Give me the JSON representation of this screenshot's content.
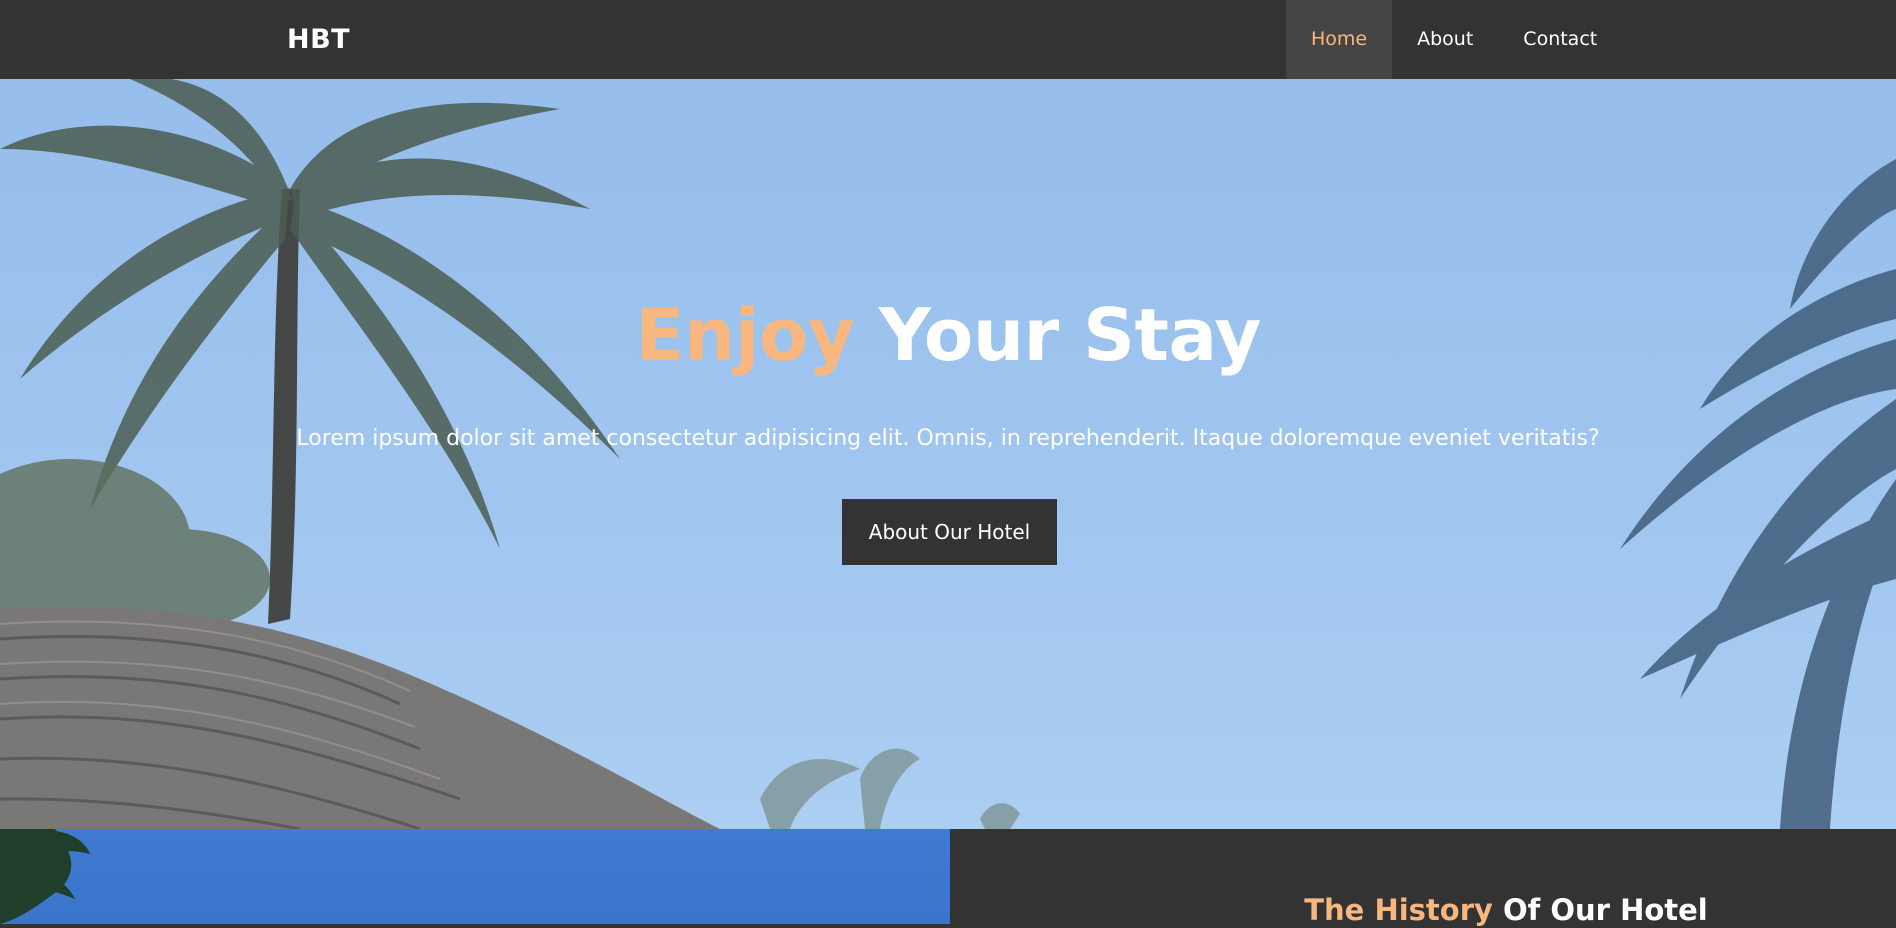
{
  "navbar": {
    "brand": "HBT",
    "links": [
      {
        "label": "Home",
        "active": true
      },
      {
        "label": "About",
        "active": false
      },
      {
        "label": "Contact",
        "active": false
      }
    ]
  },
  "hero": {
    "title_accent": "Enjoy",
    "title_rest": " Your Stay",
    "text": "Lorem ipsum dolor sit amet consectetur adipisicing elit. Omnis, in reprehenderit. Itaque doloremque eveniet veritatis?",
    "button_label": "About Our Hotel"
  },
  "history": {
    "title_accent": "The History",
    "title_rest": " Of Our Hotel"
  },
  "colors": {
    "accent": "#f7b77e",
    "dark": "#333333",
    "nav_active_bg": "#444444",
    "sky": "#a4c9f2"
  }
}
